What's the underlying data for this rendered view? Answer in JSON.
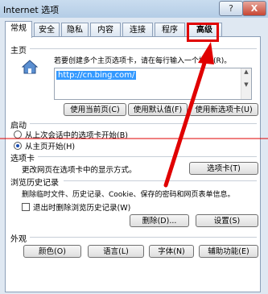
{
  "window": {
    "title": "Internet 选项",
    "help": "?",
    "close": "X"
  },
  "tabs": [
    "常规",
    "安全",
    "隐私",
    "内容",
    "连接",
    "程序",
    "高级"
  ],
  "home": {
    "heading": "主页",
    "hint": "若要创建多个主页选项卡，请在每行输入一个地址(R)。",
    "url": "http://cn.bing.com/",
    "btn_current": "使用当前页(C)",
    "btn_default": "使用默认值(F)",
    "btn_newtab": "使用新选项卡(U)"
  },
  "startup": {
    "heading": "启动",
    "opt1": "从上次会话中的选项卡开始(B)",
    "opt2": "从主页开始(H)",
    "selected": "从主页开始(H)"
  },
  "tabsec": {
    "heading": "选项卡",
    "desc": "更改网页在选项卡中的显示方式。",
    "btn": "选项卡(T)"
  },
  "history": {
    "heading": "浏览历史记录",
    "desc": "删除临时文件、历史记录、Cookie、保存的密码和网页表单信息。",
    "check": "退出时删除浏览历史记录(W)",
    "btn_delete": "删除(D)...",
    "btn_settings": "设置(S)"
  },
  "appearance": {
    "heading": "外观",
    "btn_colors": "颜色(O)",
    "btn_lang": "语言(L)",
    "btn_fonts": "字体(N)",
    "btn_access": "辅助功能(E)"
  },
  "colors": {
    "annotation": "#e00000",
    "selection": "#3399ff"
  }
}
